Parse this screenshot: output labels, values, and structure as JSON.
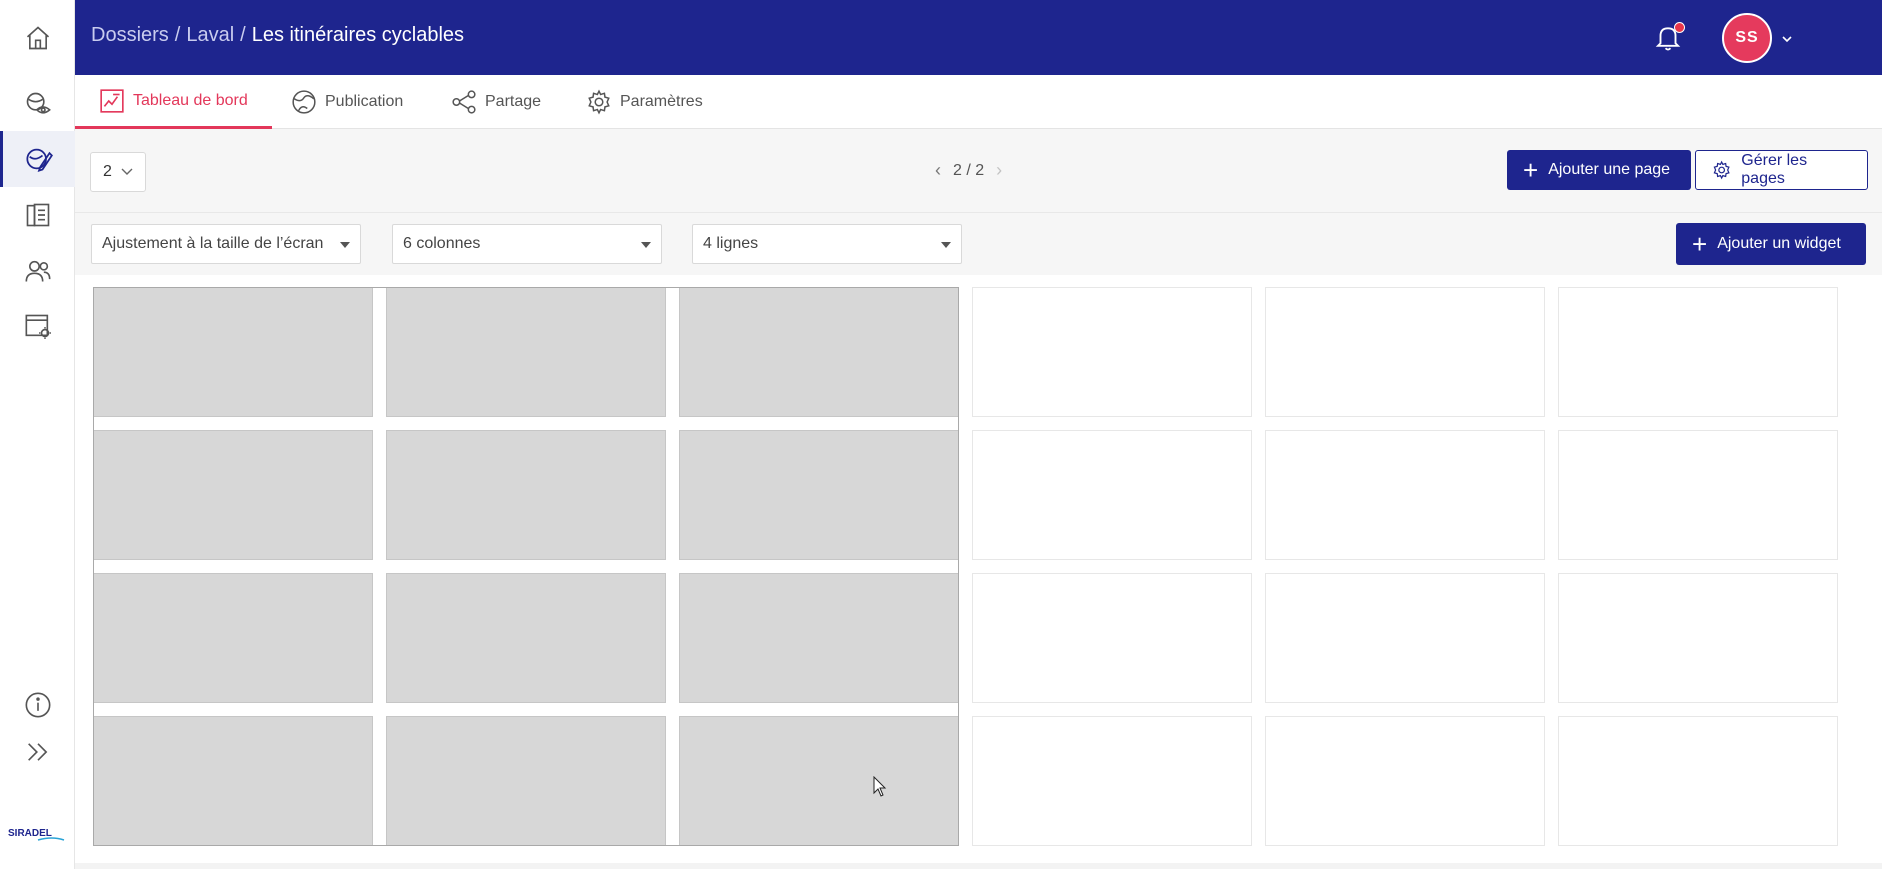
{
  "breadcrumb": {
    "items": [
      "Dossiers",
      "Laval"
    ],
    "separator": "/",
    "current": "Les itinéraires cyclables"
  },
  "user": {
    "initials": "SS"
  },
  "colors": {
    "header_bg": "#1e258e",
    "accent": "#e3375a",
    "avatar": "#e53a5d",
    "selected_cell": "#d7d7d7"
  },
  "sidebar": {
    "items": [
      {
        "icon": "home-icon"
      },
      {
        "icon": "eye-globe-icon"
      },
      {
        "icon": "edit-map-icon",
        "active": true
      },
      {
        "icon": "report-list-icon"
      },
      {
        "icon": "users-icon"
      },
      {
        "icon": "settings-window-icon"
      }
    ],
    "bottom": [
      {
        "icon": "info-icon"
      },
      {
        "icon": "expand-chevrons-icon"
      }
    ],
    "logo": "SIRADEL"
  },
  "tabs": [
    {
      "label": "Tableau de bord",
      "icon": "dashboard-icon",
      "active": true
    },
    {
      "label": "Publication",
      "icon": "globe-icon"
    },
    {
      "label": "Partage",
      "icon": "share-icon"
    },
    {
      "label": "Paramètres",
      "icon": "gear-icon"
    }
  ],
  "page_bar": {
    "page_select_value": "2",
    "pager": "2 / 2",
    "add_page_label": "Ajouter une page",
    "manage_pages_label": "Gérer les pages"
  },
  "grid_bar": {
    "fit_select": "Ajustement à la taille de l’écran",
    "columns_select": "6 colonnes",
    "rows_select": "4 lignes",
    "add_widget_label": "Ajouter un widget"
  },
  "grid": {
    "columns": 6,
    "rows": 4,
    "selected_columns": 3,
    "selected_rows": 4
  }
}
